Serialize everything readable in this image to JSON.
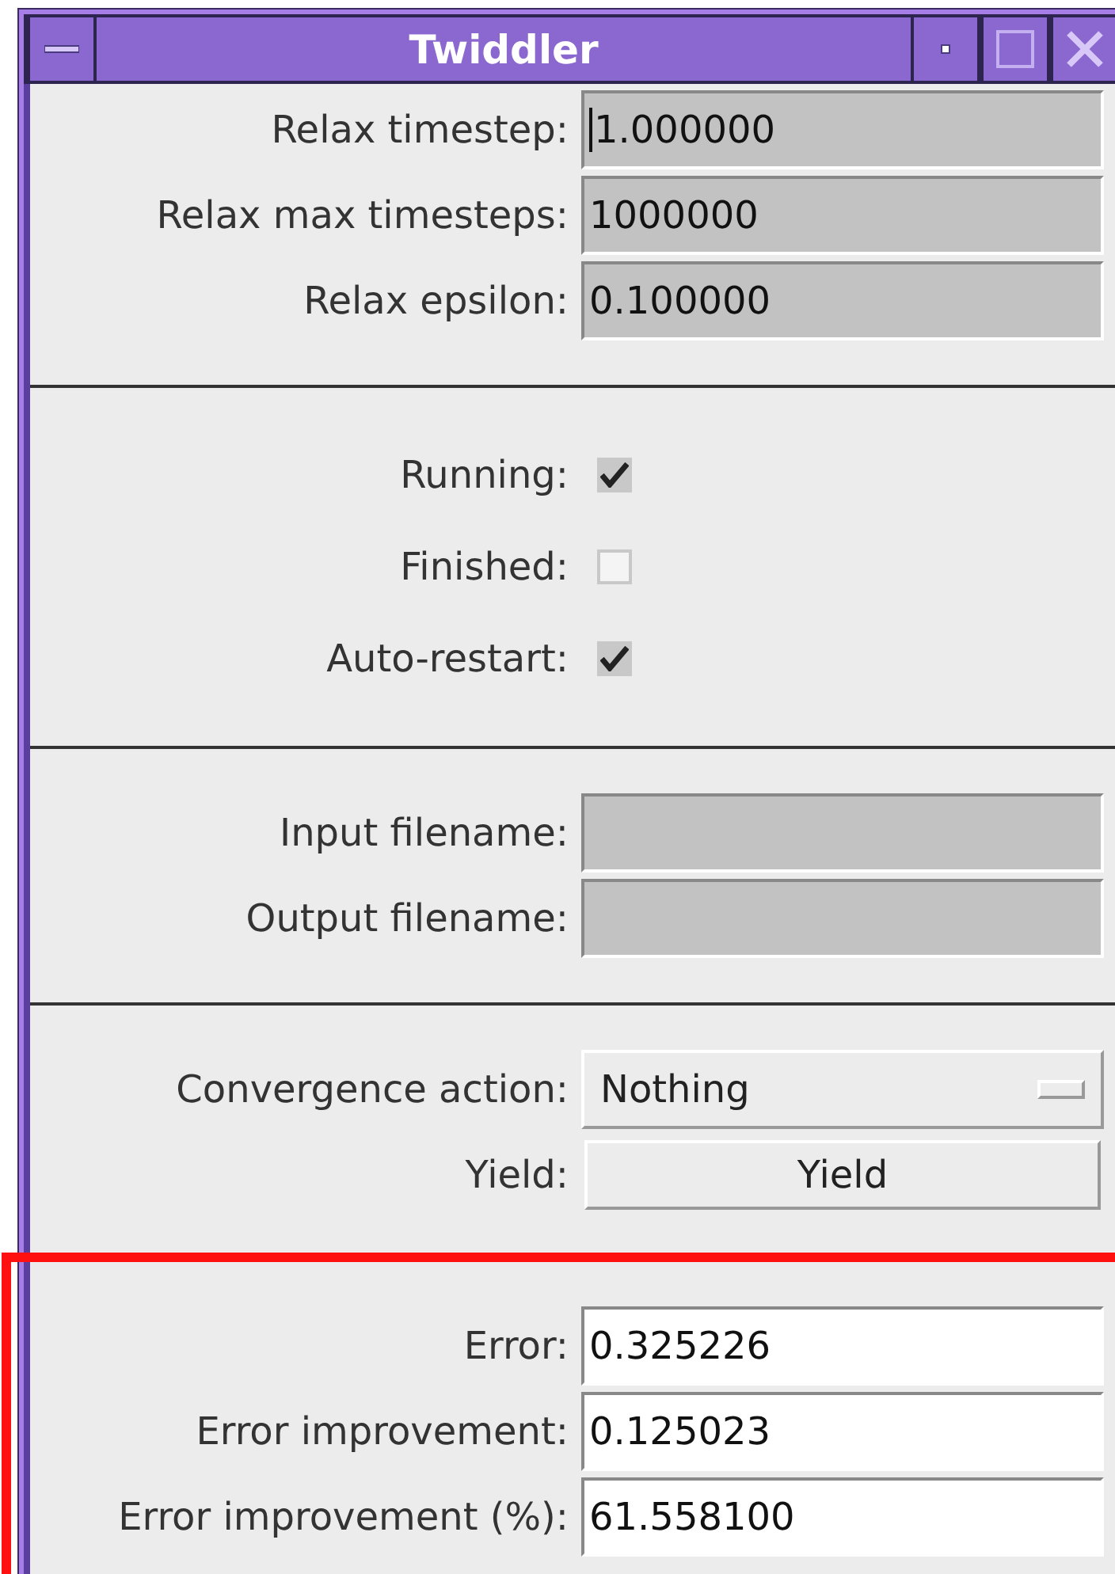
{
  "window": {
    "title": "Twiddler"
  },
  "sections": [
    {
      "highlighted": false,
      "rows": [
        {
          "kind": "entry",
          "label": "Relax timestep:",
          "value": "1.000000",
          "editable": false,
          "focused": true
        },
        {
          "kind": "entry",
          "label": "Relax max timesteps:",
          "value": "1000000",
          "editable": false,
          "focused": false
        },
        {
          "kind": "entry",
          "label": "Relax epsilon:",
          "value": "0.100000",
          "editable": false,
          "focused": false
        }
      ]
    },
    {
      "highlighted": false,
      "rows": [
        {
          "kind": "checkbox",
          "label": "Running:",
          "checked": true
        },
        {
          "kind": "checkbox",
          "label": "Finished:",
          "checked": false
        },
        {
          "kind": "checkbox",
          "label": "Auto-restart:",
          "checked": true
        }
      ]
    },
    {
      "highlighted": false,
      "rows": [
        {
          "kind": "entry",
          "label": "Input filename:",
          "editable": false,
          "focused": false
        },
        {
          "kind": "entry",
          "label": "Output filename:",
          "editable": false,
          "focused": false
        }
      ]
    },
    {
      "highlighted": false,
      "rows": [
        {
          "kind": "dropdown",
          "label": "Convergence action:",
          "value": "Nothing"
        },
        {
          "kind": "button",
          "label": "Yield:",
          "value": "Yield"
        }
      ]
    },
    {
      "highlighted": true,
      "rows": [
        {
          "kind": "entry",
          "label": "Error:",
          "value": "0.325226",
          "editable": true,
          "focused": false
        },
        {
          "kind": "entry",
          "label": "Error improvement:",
          "value": "0.125023",
          "editable": true,
          "focused": false
        },
        {
          "kind": "entry",
          "label": "Error improvement (%):",
          "value": "61.558100",
          "editable": true,
          "focused": false
        }
      ]
    }
  ]
}
